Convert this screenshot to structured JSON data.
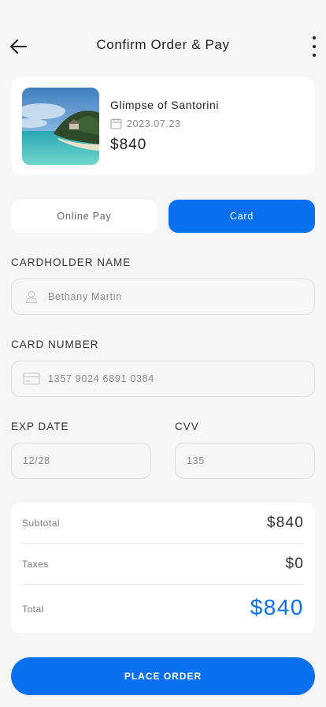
{
  "header": {
    "title": "Confirm Order & Pay"
  },
  "product": {
    "name": "Glimpse of Santorini",
    "date": "2023.07.23",
    "price": "$840"
  },
  "payment_tabs": {
    "online": "Online Pay",
    "card": "Card",
    "selected": "card"
  },
  "form": {
    "cardholder_label": "CARDHOLDER NAME",
    "cardholder_value": "Bethany Martin",
    "card_number_label": "CARD NUMBER",
    "card_number_value": "1357 9024 6891 0384",
    "exp_label": "EXP DATE",
    "exp_value": "12/28",
    "cvv_label": "CVV",
    "cvv_value": "135"
  },
  "summary": {
    "subtotal_label": "Subtotal",
    "subtotal_value": "$840",
    "taxes_label": "Taxes",
    "taxes_value": "$0",
    "total_label": "Total",
    "total_value": "$840"
  },
  "cta": {
    "label": "PLACE ORDER"
  },
  "colors": {
    "accent": "#0870ef",
    "background": "#f6f6f7"
  }
}
